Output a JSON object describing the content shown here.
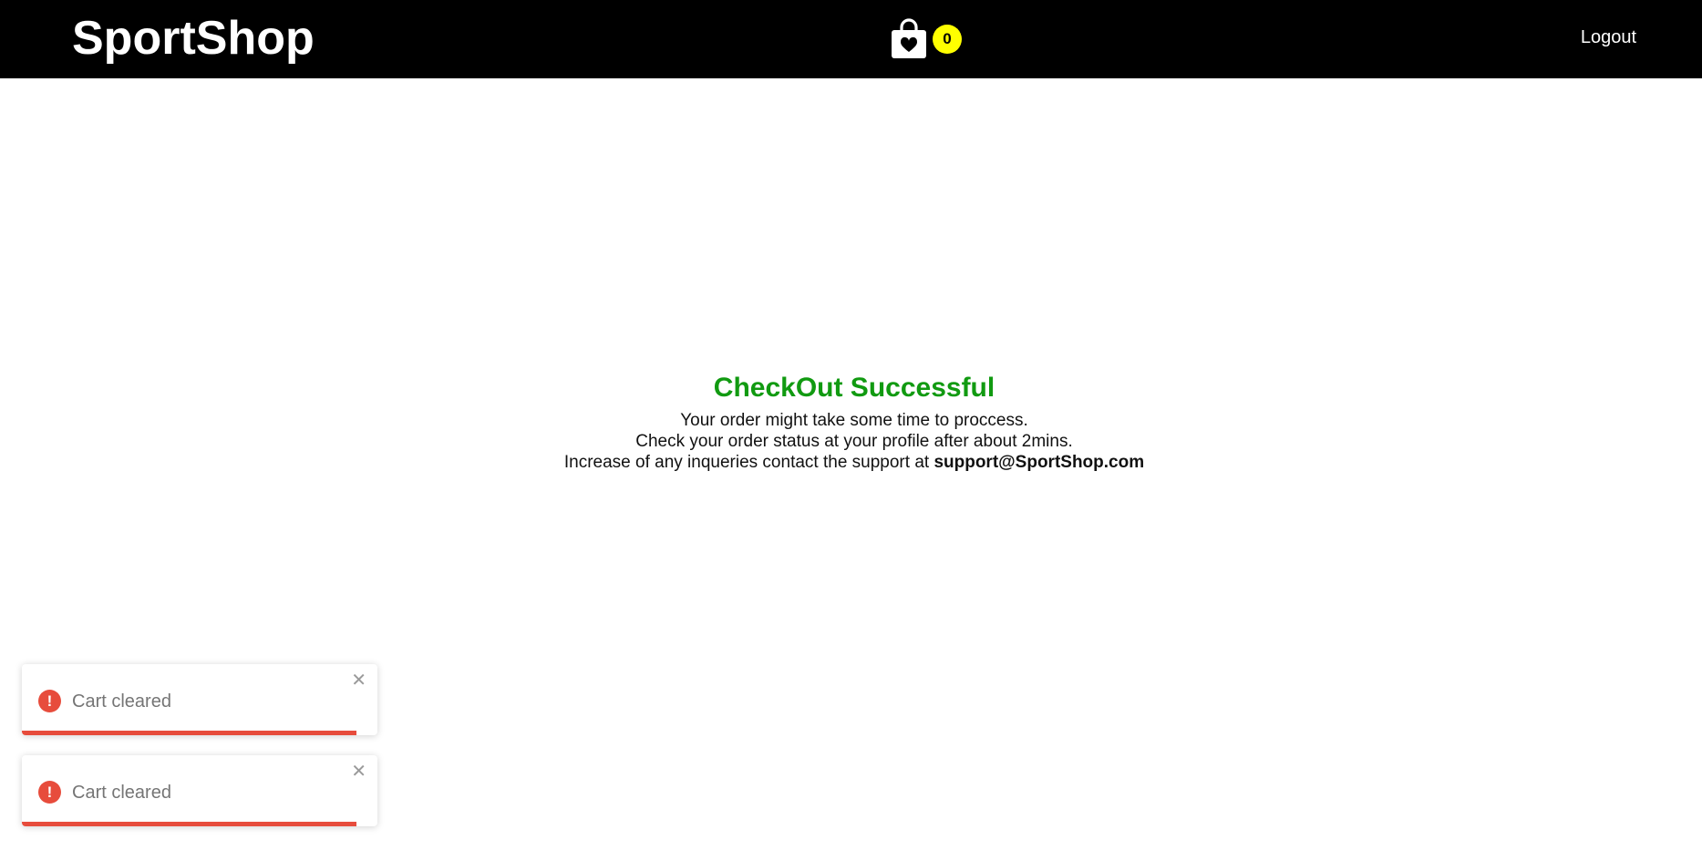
{
  "navbar": {
    "brand": "SportShop",
    "cart_count": "0",
    "cart_icon": "shopping-bag-heart-icon",
    "logout_label": "Logout",
    "background": "#000000",
    "badge_color": "#ffff00"
  },
  "main": {
    "title": "CheckOut Successful",
    "title_color": "#119a11",
    "line1": "Your order might take some time to proccess.",
    "line2": "Check your order status at your profile after about 2mins.",
    "line3_prefix": "Increase of any inqueries contact the support at ",
    "support_email": "support@SportShop.com"
  },
  "toasts": [
    {
      "message": "Cart cleared",
      "icon": "error-icon",
      "close_icon": "close-icon",
      "progress": 0.94
    },
    {
      "message": "Cart cleared",
      "icon": "error-icon",
      "close_icon": "close-icon",
      "progress": 0.94
    }
  ],
  "colors": {
    "toast_accent": "#e74c3c"
  }
}
